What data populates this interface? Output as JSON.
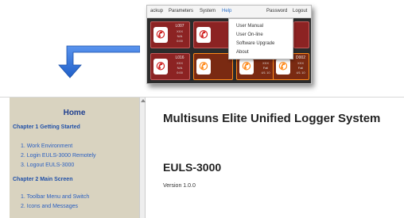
{
  "inset": {
    "menubar": {
      "items": [
        "ackup",
        "Parameters",
        "System",
        "Help",
        "Password",
        "Logout"
      ]
    },
    "help_menu": {
      "items": [
        "User Manual",
        "User On-line",
        "Software Upgrade",
        "About"
      ]
    },
    "tiles": [
      {
        "id": "L007",
        "line1": "XXX",
        "line2": "N/A",
        "line3": "0:00",
        "style": "red"
      },
      {
        "id": "L016",
        "line1": "XXX",
        "line2": "N/A",
        "line3": "0:00",
        "style": "red"
      },
      {
        "id": "D001",
        "line1": "XXX",
        "line2": "Fail",
        "line3": "4/1 10",
        "style": "orange"
      },
      {
        "id": "D002",
        "line1": "XXX",
        "line2": "Fail",
        "line3": "4/1 10",
        "style": "orange"
      }
    ],
    "colors": {
      "tile_red": "#8c2323",
      "tile_orange_border": "#ff8a1a",
      "menu_active": "#2a6fc9"
    }
  },
  "arrow": {
    "color": "#2f6fd6",
    "icon": "arrow-down-left-icon"
  },
  "help_window": {
    "sidebar": {
      "home": "Home",
      "chapters": [
        {
          "title": "Chapter 1 Getting Started",
          "items": [
            "1. Work Environment",
            "2. Login EULS-3000 Remotely",
            "3. Logout EULS-3000"
          ]
        },
        {
          "title": "Chapter 2 Main Screen",
          "items": [
            "1. Toolbar Menu and Switch",
            "2. Icons and Messages"
          ]
        }
      ]
    },
    "content": {
      "title": "Multisuns Elite Unified Logger System",
      "product": "EULS-3000",
      "version": "Version 1.0.0"
    },
    "colors": {
      "sidebar_bg": "#d9d3c0",
      "link": "#2a5fc0"
    }
  }
}
